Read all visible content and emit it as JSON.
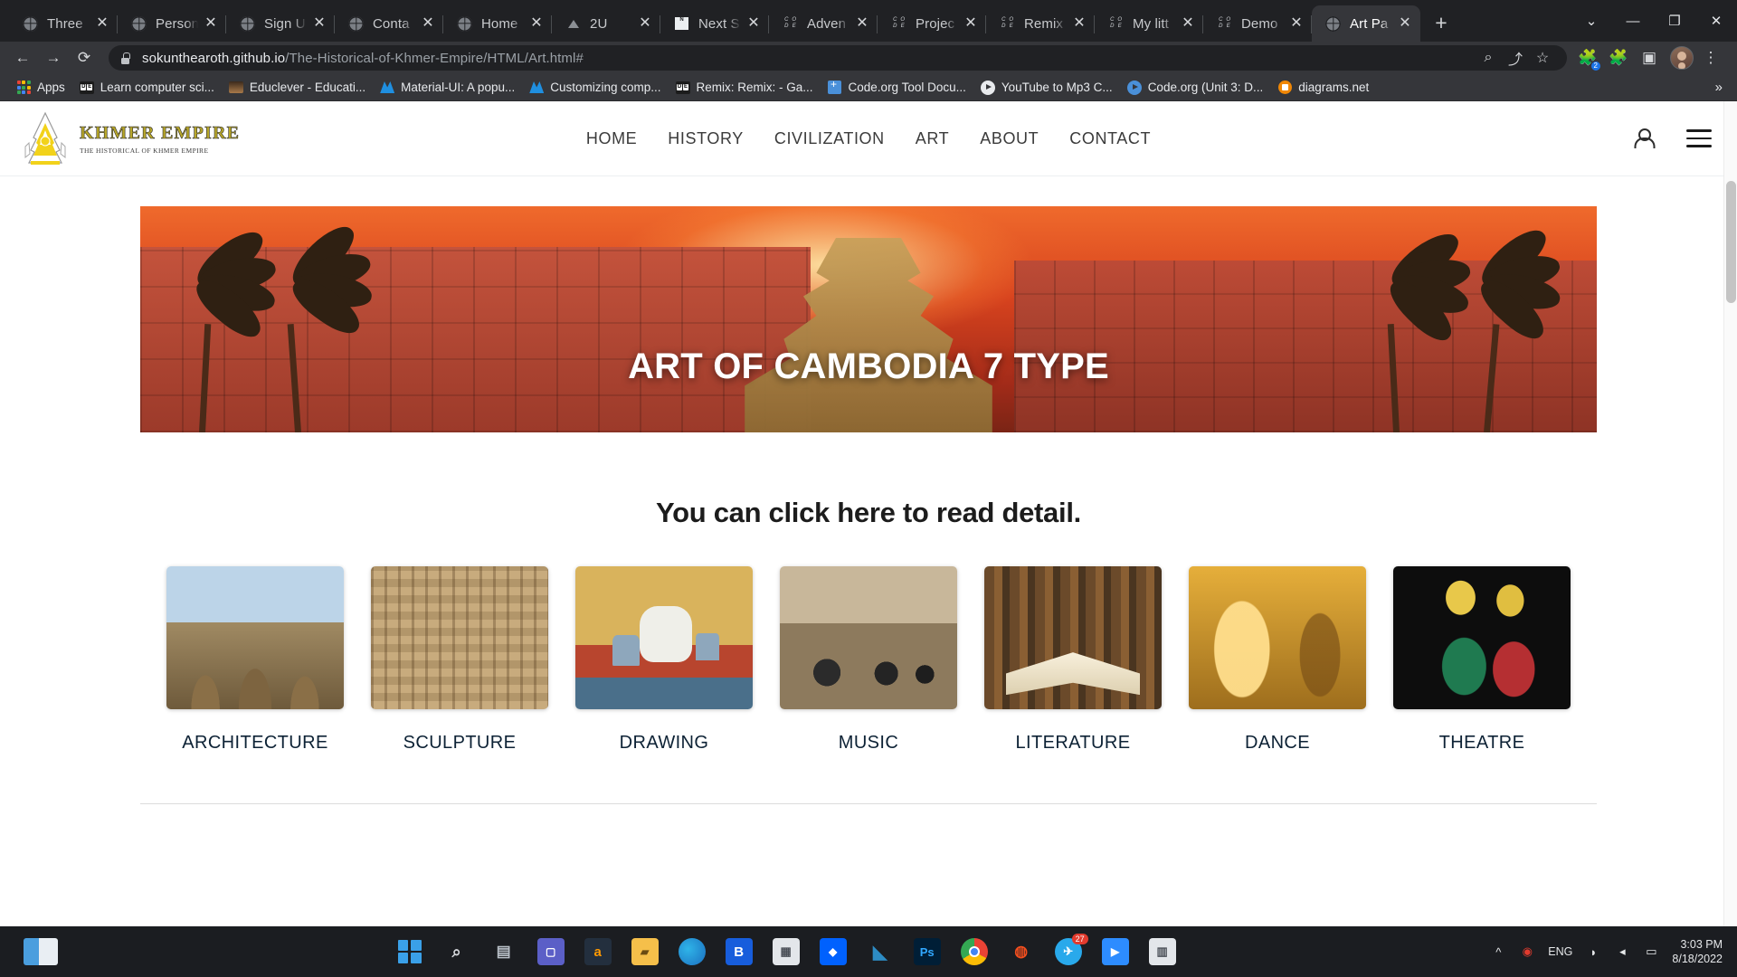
{
  "browser": {
    "tabs": [
      {
        "title": "Three",
        "favicon": "globe-icon",
        "active": false
      },
      {
        "title": "Person",
        "favicon": "globe-icon",
        "active": false
      },
      {
        "title": "Sign U",
        "favicon": "globe-icon",
        "active": false
      },
      {
        "title": "Conta",
        "favicon": "globe-icon",
        "active": false
      },
      {
        "title": "Home",
        "favicon": "globe-icon",
        "active": false
      },
      {
        "title": "2U",
        "favicon": "triangle-icon",
        "active": false
      },
      {
        "title": "Next S",
        "favicon": "next-icon",
        "active": false
      },
      {
        "title": "Adven",
        "favicon": "code-icon",
        "active": false
      },
      {
        "title": "Projec",
        "favicon": "code-icon",
        "active": false
      },
      {
        "title": "Remix",
        "favicon": "code-icon",
        "active": false
      },
      {
        "title": "My litt",
        "favicon": "code-icon",
        "active": false
      },
      {
        "title": "Demo",
        "favicon": "code-icon",
        "active": false
      },
      {
        "title": "Art Pa",
        "favicon": "globe-icon",
        "active": true
      }
    ],
    "new_tab_label": "+",
    "window_controls": {
      "list": "⌄",
      "minimize": "—",
      "maximize": "❐",
      "close": "✕"
    },
    "nav": {
      "back": "←",
      "forward": "→",
      "reload": "⟳"
    },
    "omnibox": {
      "lock": "lock-icon",
      "host": "sokunthearoth.github.io",
      "path": "/The-Historical-of-Khmer-Empire/HTML/Art.html#",
      "search_icon": "search-icon",
      "share_icon": "share-icon",
      "star_icon": "star-icon",
      "extension_badge_count": "2",
      "extensions_icon": "puzzle-icon",
      "sidepanel_icon": "sidepanel-icon",
      "menu_icon": "kebab-menu-icon"
    },
    "bookmarks": [
      {
        "label": "Apps",
        "icon": "apps-grid-icon"
      },
      {
        "label": "Learn computer sci...",
        "icon": "code-org-icon"
      },
      {
        "label": "Educlever - Educati...",
        "icon": "image-icon"
      },
      {
        "label": "Material-UI: A popu...",
        "icon": "material-ui-icon"
      },
      {
        "label": "Customizing comp...",
        "icon": "material-ui-icon"
      },
      {
        "label": "Remix: Remix: - Ga...",
        "icon": "code-org-icon"
      },
      {
        "label": "Code.org Tool Docu...",
        "icon": "code-org-grid-icon"
      },
      {
        "label": "YouTube to Mp3 C...",
        "icon": "youtube-icon"
      },
      {
        "label": "Code.org (Unit 3: D...",
        "icon": "code-org-circle-icon"
      },
      {
        "label": "diagrams.net",
        "icon": "diagrams-icon"
      }
    ],
    "bookmarks_overflow": "»"
  },
  "site": {
    "brand": {
      "title": "KHMER EMPIRE",
      "subtitle": "THE HISTORICAL OF KHMER EMPIRE",
      "logo": "khmer-temple-logo-icon"
    },
    "nav": [
      {
        "label": "HOME"
      },
      {
        "label": "HISTORY"
      },
      {
        "label": "CIVILIZATION"
      },
      {
        "label": "ART"
      },
      {
        "label": "ABOUT"
      },
      {
        "label": "CONTACT"
      }
    ],
    "account_icon": "person-icon",
    "menu_icon": "hamburger-menu-icon",
    "hero": {
      "title": "ART OF CAMBODIA 7 TYPE"
    },
    "section_heading": "You can click here to read detail.",
    "cards": [
      {
        "label": "ARCHITECTURE",
        "art": "art-arch"
      },
      {
        "label": "SCULPTURE",
        "art": "art-sculpt"
      },
      {
        "label": "DRAWING",
        "art": "art-draw"
      },
      {
        "label": "MUSIC",
        "art": "art-music"
      },
      {
        "label": "LITERATURE",
        "art": "art-lit"
      },
      {
        "label": "DANCE",
        "art": "art-dance"
      },
      {
        "label": "THEATRE",
        "art": "art-theatre"
      }
    ]
  },
  "taskbar": {
    "widgets_icon": "widgets-icon",
    "items": [
      {
        "name": "start-button",
        "icon": "windows-logo-icon",
        "label": "",
        "color": "#3aa0e8"
      },
      {
        "name": "search-button",
        "icon": "search-icon",
        "label": "",
        "color": "#d8dade"
      },
      {
        "name": "task-view-button",
        "icon": "task-view-icon",
        "label": "",
        "color": "#9aa3ad"
      },
      {
        "name": "teams-button",
        "icon": "teams-icon",
        "label": "",
        "color": "#5b5fc7"
      },
      {
        "name": "amazon-button",
        "icon": "amazon-icon",
        "label": "a",
        "color": "#ff9900"
      },
      {
        "name": "file-explorer-button",
        "icon": "folder-icon",
        "label": "",
        "color": "#f5bf4a"
      },
      {
        "name": "edge-button",
        "icon": "edge-icon",
        "label": "",
        "color": "#2f8fd8"
      },
      {
        "name": "bitwarden-button",
        "icon": "bitwarden-icon",
        "label": "B",
        "color": "#175ddc"
      },
      {
        "name": "store-button",
        "icon": "microsoft-store-icon",
        "label": "",
        "color": "#e3e6ea"
      },
      {
        "name": "dropbox-button",
        "icon": "dropbox-icon",
        "label": "",
        "color": "#0061fe"
      },
      {
        "name": "vscode-button",
        "icon": "vscode-icon",
        "label": "",
        "color": "#2d8cc4"
      },
      {
        "name": "photoshop-button",
        "icon": "photoshop-icon",
        "label": "Ps",
        "color": "#31a8ff"
      },
      {
        "name": "chrome-button",
        "icon": "chrome-icon",
        "label": "",
        "color": "#4285f4"
      },
      {
        "name": "figma-button",
        "icon": "figma-icon",
        "label": "",
        "color": "#f24e1e"
      },
      {
        "name": "telegram-button",
        "icon": "telegram-icon",
        "label": "",
        "color": "#29a9eb",
        "badge": "27"
      },
      {
        "name": "zoom-button",
        "icon": "zoom-icon",
        "label": "",
        "color": "#2d8cff"
      },
      {
        "name": "calendar-button",
        "icon": "calendar-icon",
        "label": "",
        "color": "#d8dade"
      }
    ],
    "tray": {
      "chevron": "^",
      "notification_icon": "notification-mute-icon",
      "language": "ENG",
      "wifi_icon": "wifi-icon",
      "volume_icon": "volume-mute-icon",
      "battery_icon": "battery-icon",
      "time": "3:03 PM",
      "date": "8/18/2022"
    }
  },
  "colors": {
    "chrome_dark": "#202124",
    "chrome_toolbar": "#35363a",
    "brand_gold": "#b8a72a",
    "hero_orange": "#d8431e",
    "card_label": "#0d2235",
    "taskbar": "#1b1d21"
  }
}
